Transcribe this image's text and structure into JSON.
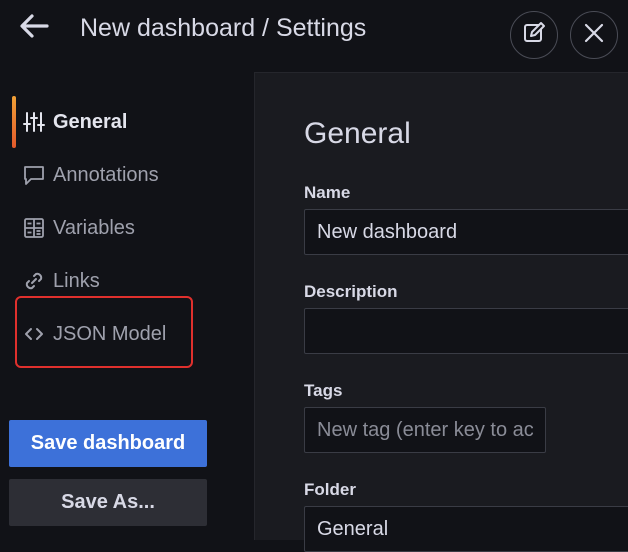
{
  "header": {
    "title": "New dashboard / Settings",
    "back_icon": "arrow-left-icon",
    "edit_icon": "edit-icon",
    "close_icon": "close-icon"
  },
  "sidebar": {
    "items": [
      {
        "label": "General",
        "icon": "sliders-icon",
        "active": true
      },
      {
        "label": "Annotations",
        "icon": "comment-icon",
        "active": false
      },
      {
        "label": "Variables",
        "icon": "grid-calculator-icon",
        "active": false
      },
      {
        "label": "Links",
        "icon": "link-icon",
        "active": false
      },
      {
        "label": "JSON Model",
        "icon": "code-brackets-icon",
        "active": false
      }
    ],
    "highlighted_item": "JSON Model",
    "highlight_color": "#e0302d",
    "save_label": "Save dashboard",
    "save_as_label": "Save As..."
  },
  "main": {
    "section_title": "General",
    "name_label": "Name",
    "name_value": "New dashboard",
    "description_label": "Description",
    "description_value": "",
    "tags_label": "Tags",
    "tags_placeholder": "New tag (enter key to ac",
    "folder_label": "Folder",
    "folder_value": "General"
  },
  "colors": {
    "primary_button": "#3d71d9",
    "active_indicator_top": "#f0a036",
    "active_indicator_bottom": "#e3592b"
  }
}
